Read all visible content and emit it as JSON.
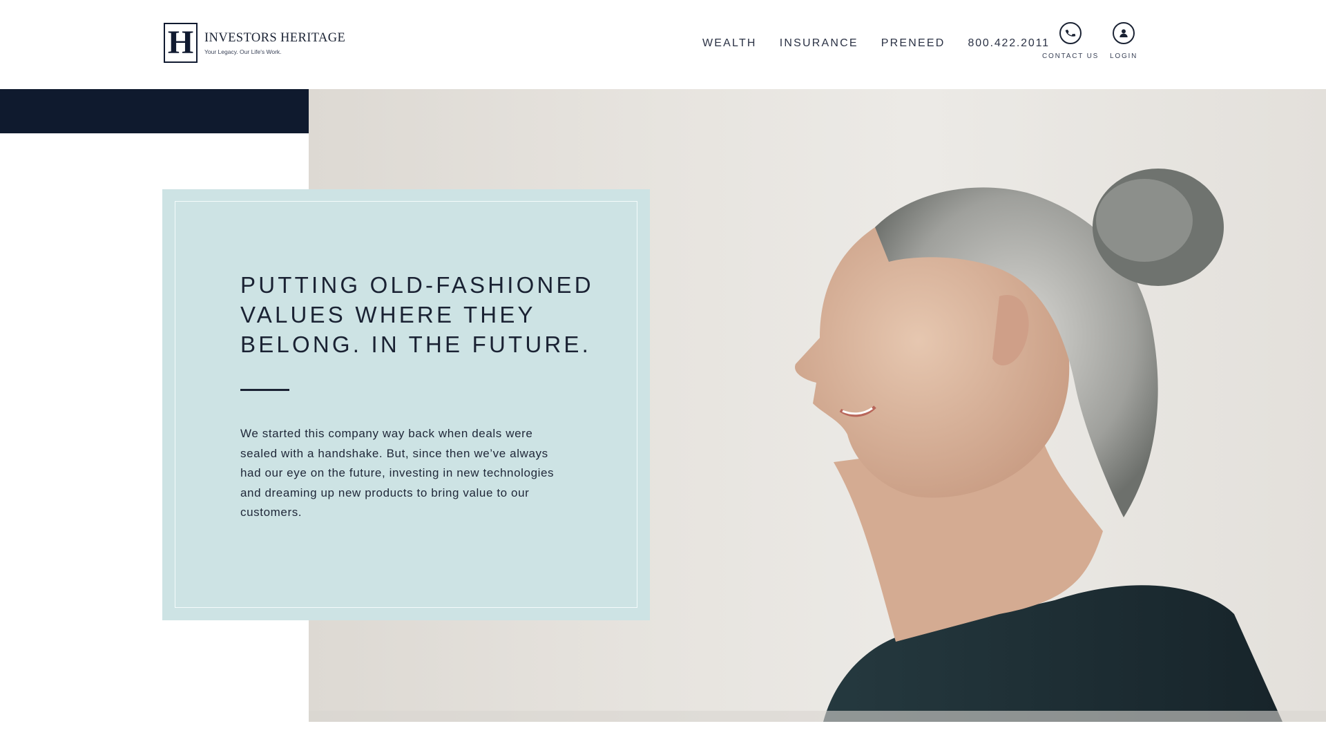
{
  "brand": {
    "mark": "H",
    "name": "INVESTORS HERITAGE",
    "tagline": "Your Legacy. Our Life's Work."
  },
  "nav": {
    "items": [
      "WEALTH",
      "INSURANCE",
      "PRENEED"
    ],
    "phone": "800.422.2011",
    "contact_label": "CONTACT US",
    "login_label": "LOGIN"
  },
  "hero": {
    "headline": "PUTTING OLD-FASHIONED VALUES WHERE THEY BELONG. IN THE FUTURE.",
    "body": "We started this company way back when deals were sealed with a handshake. But, since then we’ve always had our eye on the future, investing in new technologies and dreaming up new products to bring value to our customers."
  },
  "colors": {
    "navy": "#0f1a2e",
    "card": "#cde3e4",
    "text": "#1a2233"
  }
}
